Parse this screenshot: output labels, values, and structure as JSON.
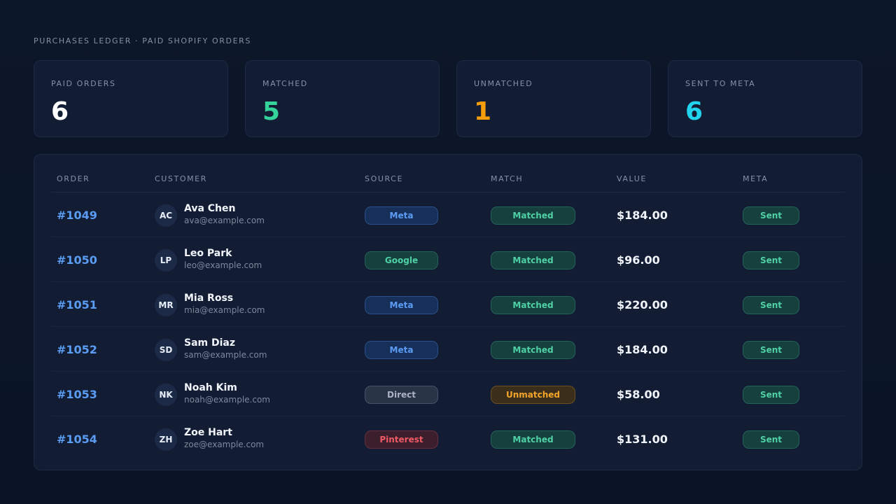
{
  "page": {
    "title": "PURCHASES LEDGER · PAID SHOPIFY ORDERS"
  },
  "stats": [
    {
      "label": "PAID ORDERS",
      "value": "6",
      "color": "#ffffff"
    },
    {
      "label": "MATCHED",
      "value": "5",
      "color": "#34d399"
    },
    {
      "label": "UNMATCHED",
      "value": "1",
      "color": "#f59e0b"
    },
    {
      "label": "SENT TO META",
      "value": "6",
      "color": "#22d3ee"
    }
  ],
  "table": {
    "headers": {
      "order": "ORDER",
      "customer": "CUSTOMER",
      "source": "SOURCE",
      "match": "MATCH",
      "value": "VALUE",
      "meta": "META"
    },
    "rows": [
      {
        "order": "#1049",
        "initials": "AC",
        "name": "Ava Chen",
        "email": "ava@example.com",
        "source": "Meta",
        "source_kind": "meta",
        "match": "Matched",
        "match_kind": "matched",
        "value": "$184.00",
        "meta": "Sent"
      },
      {
        "order": "#1050",
        "initials": "LP",
        "name": "Leo Park",
        "email": "leo@example.com",
        "source": "Google",
        "source_kind": "google",
        "match": "Matched",
        "match_kind": "matched",
        "value": "$96.00",
        "meta": "Sent"
      },
      {
        "order": "#1051",
        "initials": "MR",
        "name": "Mia Ross",
        "email": "mia@example.com",
        "source": "Meta",
        "source_kind": "meta",
        "match": "Matched",
        "match_kind": "matched",
        "value": "$220.00",
        "meta": "Sent"
      },
      {
        "order": "#1052",
        "initials": "SD",
        "name": "Sam Diaz",
        "email": "sam@example.com",
        "source": "Meta",
        "source_kind": "meta",
        "match": "Matched",
        "match_kind": "matched",
        "value": "$184.00",
        "meta": "Sent"
      },
      {
        "order": "#1053",
        "initials": "NK",
        "name": "Noah Kim",
        "email": "noah@example.com",
        "source": "Direct",
        "source_kind": "direct",
        "match": "Unmatched",
        "match_kind": "unmatched",
        "value": "$58.00",
        "meta": "Sent"
      },
      {
        "order": "#1054",
        "initials": "ZH",
        "name": "Zoe Hart",
        "email": "zoe@example.com",
        "source": "Pinterest",
        "source_kind": "pinterest",
        "match": "Matched",
        "match_kind": "matched",
        "value": "$131.00",
        "meta": "Sent"
      }
    ]
  }
}
